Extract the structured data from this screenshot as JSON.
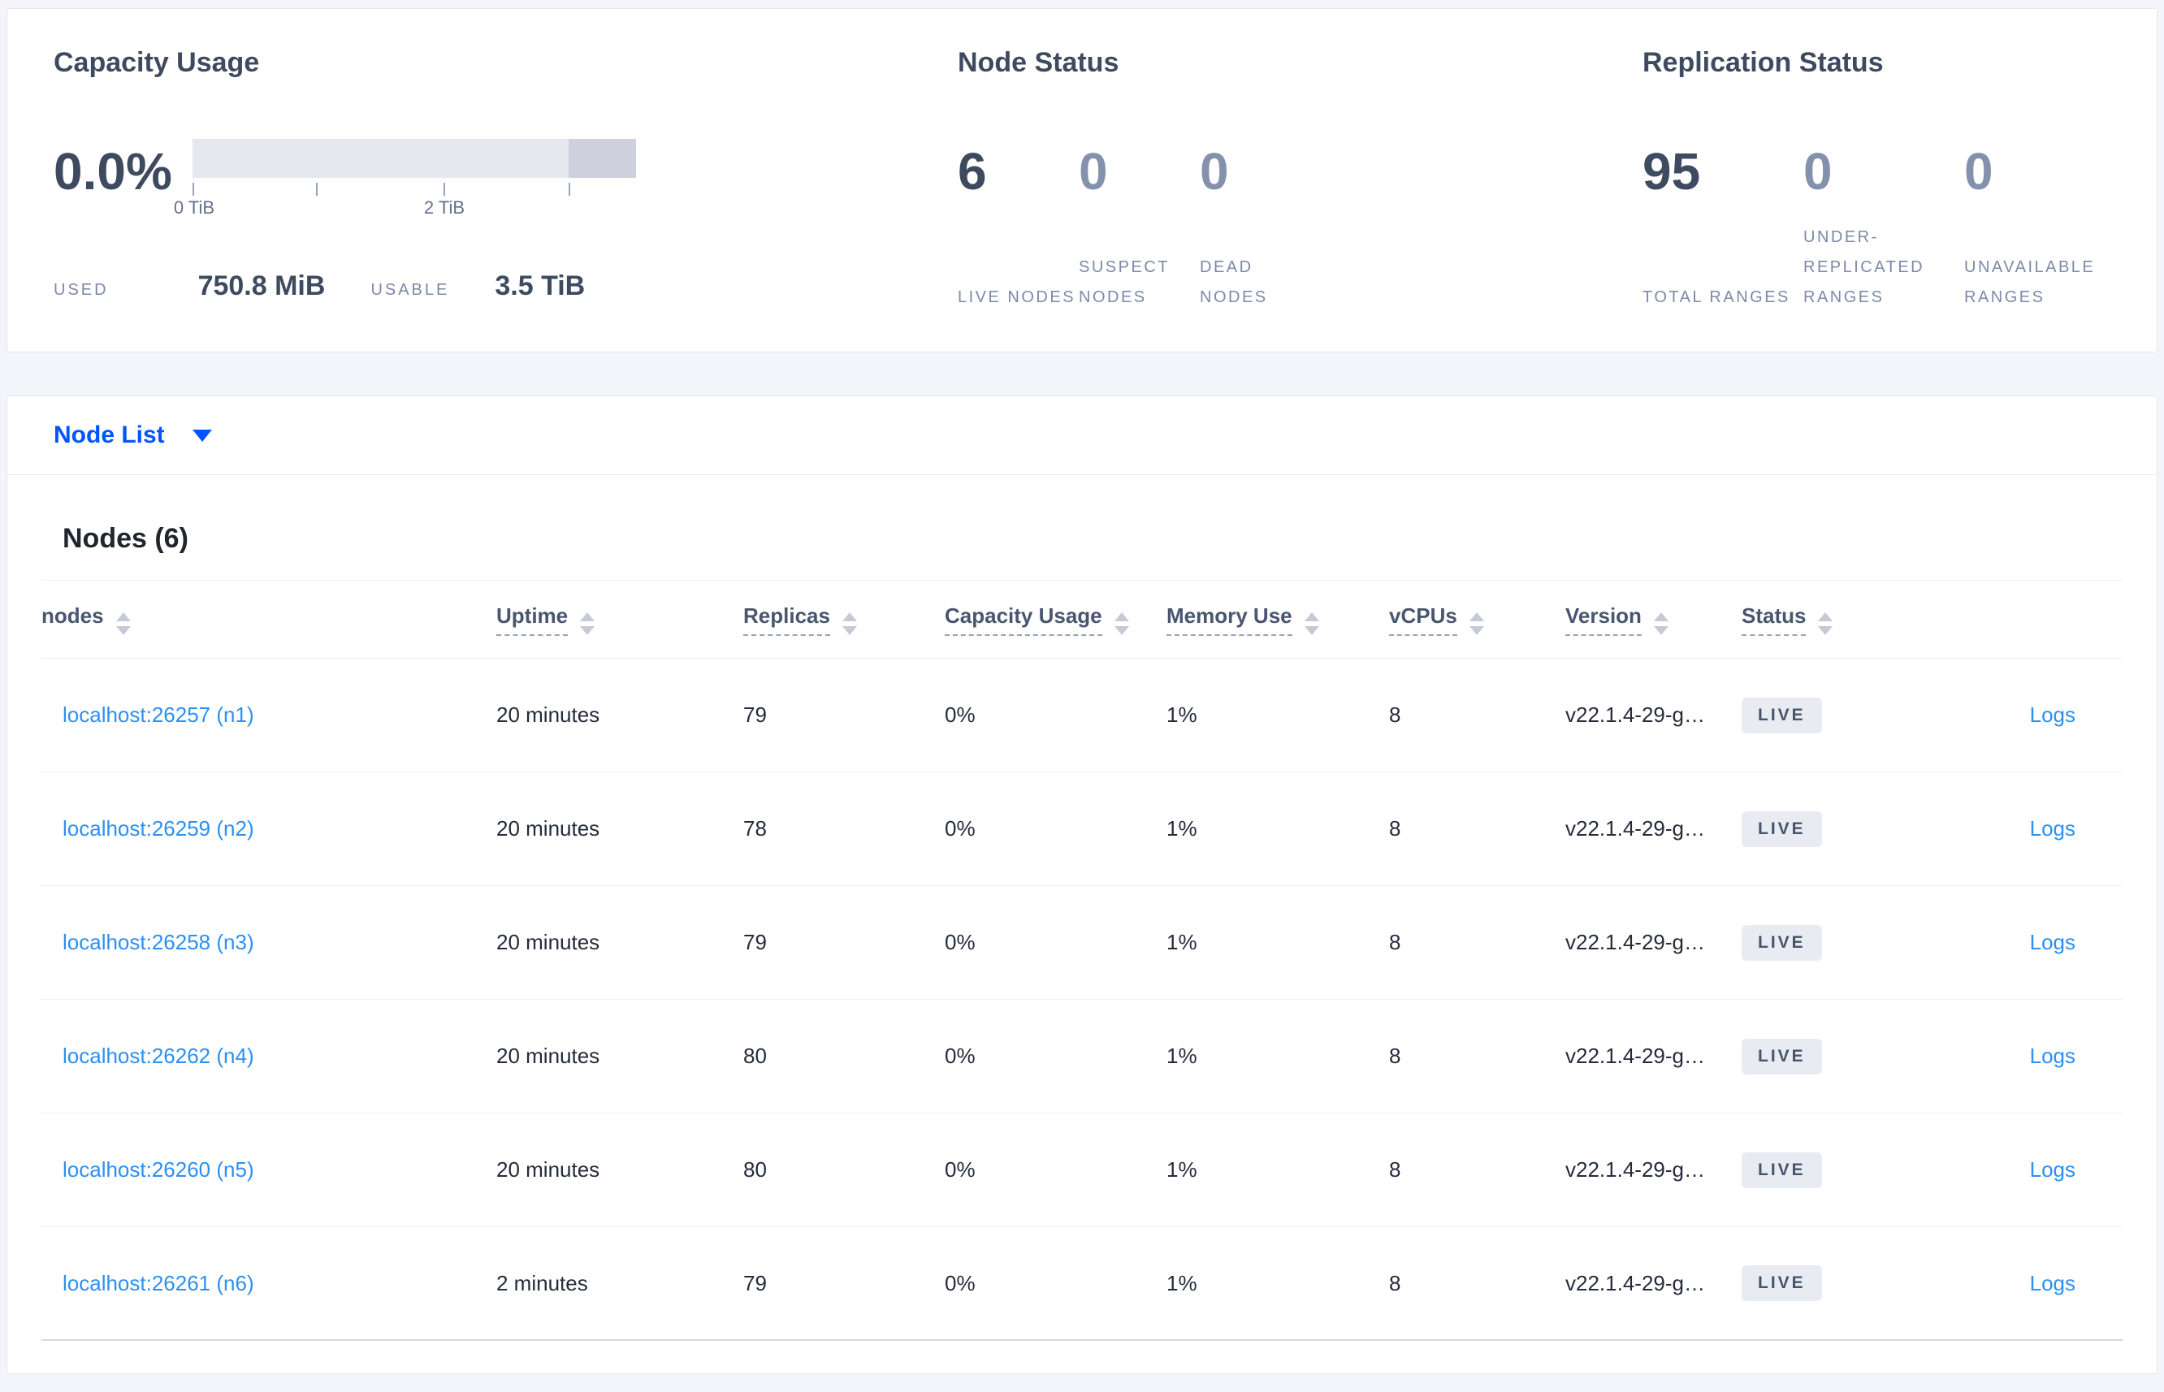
{
  "overview": {
    "capacity": {
      "title": "Capacity Usage",
      "percent": "0.0%",
      "tick_label_0": "0 TiB",
      "tick_label_2": "2 TiB",
      "used_label": "USED",
      "used_value": "750.8 MiB",
      "usable_label": "USABLE",
      "usable_value": "3.5 TiB"
    },
    "node_status": {
      "title": "Node Status",
      "stats": [
        {
          "value": "6",
          "label": "LIVE NODES",
          "emphasis": true
        },
        {
          "value": "0",
          "label": "SUSPECT NODES",
          "emphasis": false
        },
        {
          "value": "0",
          "label": "DEAD NODES",
          "emphasis": false
        }
      ]
    },
    "replication": {
      "title": "Replication Status",
      "stats": [
        {
          "value": "95",
          "label": "TOTAL RANGES",
          "emphasis": true
        },
        {
          "value": "0",
          "label": "UNDER-REPLICATED RANGES",
          "emphasis": false
        },
        {
          "value": "0",
          "label": "UNAVAILABLE RANGES",
          "emphasis": false
        }
      ]
    }
  },
  "view_selector": {
    "label": "Node List"
  },
  "nodes_section": {
    "title": "Nodes (6)",
    "columns": [
      {
        "label": "nodes",
        "underline": false
      },
      {
        "label": "Uptime",
        "underline": true
      },
      {
        "label": "Replicas",
        "underline": true
      },
      {
        "label": "Capacity Usage",
        "underline": true
      },
      {
        "label": "Memory Use",
        "underline": true
      },
      {
        "label": "vCPUs",
        "underline": true
      },
      {
        "label": "Version",
        "underline": true
      },
      {
        "label": "Status",
        "underline": true
      }
    ],
    "rows": [
      {
        "node": "localhost:26257 (n1)",
        "uptime": "20 minutes",
        "replicas": "79",
        "capacity": "0%",
        "memory": "1%",
        "vcpus": "8",
        "version": "v22.1.4-29-g…",
        "status": "LIVE",
        "logs": "Logs"
      },
      {
        "node": "localhost:26259 (n2)",
        "uptime": "20 minutes",
        "replicas": "78",
        "capacity": "0%",
        "memory": "1%",
        "vcpus": "8",
        "version": "v22.1.4-29-g…",
        "status": "LIVE",
        "logs": "Logs"
      },
      {
        "node": "localhost:26258 (n3)",
        "uptime": "20 minutes",
        "replicas": "79",
        "capacity": "0%",
        "memory": "1%",
        "vcpus": "8",
        "version": "v22.1.4-29-g…",
        "status": "LIVE",
        "logs": "Logs"
      },
      {
        "node": "localhost:26262 (n4)",
        "uptime": "20 minutes",
        "replicas": "80",
        "capacity": "0%",
        "memory": "1%",
        "vcpus": "8",
        "version": "v22.1.4-29-g…",
        "status": "LIVE",
        "logs": "Logs"
      },
      {
        "node": "localhost:26260 (n5)",
        "uptime": "20 minutes",
        "replicas": "80",
        "capacity": "0%",
        "memory": "1%",
        "vcpus": "8",
        "version": "v22.1.4-29-g…",
        "status": "LIVE",
        "logs": "Logs"
      },
      {
        "node": "localhost:26261 (n6)",
        "uptime": "2 minutes",
        "replicas": "79",
        "capacity": "0%",
        "memory": "1%",
        "vcpus": "8",
        "version": "v22.1.4-29-g…",
        "status": "LIVE",
        "logs": "Logs"
      }
    ]
  },
  "colors": {
    "accent_blue": "#0055ff",
    "link_blue": "#2b90f4",
    "dark_slate": "#3e4a5f",
    "muted_slate": "#7e89a7",
    "badge_bg": "#e8ebf2",
    "bar_light": "#e6e8ef",
    "bar_dark": "#ced1dd",
    "page_bg": "#f4f5fa"
  }
}
